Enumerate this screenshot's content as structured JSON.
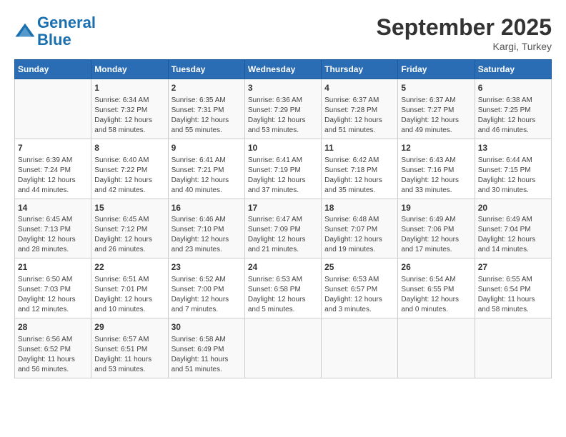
{
  "logo": {
    "line1": "General",
    "line2": "Blue"
  },
  "title": "September 2025",
  "location": "Kargi, Turkey",
  "days_of_week": [
    "Sunday",
    "Monday",
    "Tuesday",
    "Wednesday",
    "Thursday",
    "Friday",
    "Saturday"
  ],
  "weeks": [
    [
      {
        "day": "",
        "content": ""
      },
      {
        "day": "1",
        "content": "Sunrise: 6:34 AM\nSunset: 7:32 PM\nDaylight: 12 hours\nand 58 minutes."
      },
      {
        "day": "2",
        "content": "Sunrise: 6:35 AM\nSunset: 7:31 PM\nDaylight: 12 hours\nand 55 minutes."
      },
      {
        "day": "3",
        "content": "Sunrise: 6:36 AM\nSunset: 7:29 PM\nDaylight: 12 hours\nand 53 minutes."
      },
      {
        "day": "4",
        "content": "Sunrise: 6:37 AM\nSunset: 7:28 PM\nDaylight: 12 hours\nand 51 minutes."
      },
      {
        "day": "5",
        "content": "Sunrise: 6:37 AM\nSunset: 7:27 PM\nDaylight: 12 hours\nand 49 minutes."
      },
      {
        "day": "6",
        "content": "Sunrise: 6:38 AM\nSunset: 7:25 PM\nDaylight: 12 hours\nand 46 minutes."
      }
    ],
    [
      {
        "day": "7",
        "content": "Sunrise: 6:39 AM\nSunset: 7:24 PM\nDaylight: 12 hours\nand 44 minutes."
      },
      {
        "day": "8",
        "content": "Sunrise: 6:40 AM\nSunset: 7:22 PM\nDaylight: 12 hours\nand 42 minutes."
      },
      {
        "day": "9",
        "content": "Sunrise: 6:41 AM\nSunset: 7:21 PM\nDaylight: 12 hours\nand 40 minutes."
      },
      {
        "day": "10",
        "content": "Sunrise: 6:41 AM\nSunset: 7:19 PM\nDaylight: 12 hours\nand 37 minutes."
      },
      {
        "day": "11",
        "content": "Sunrise: 6:42 AM\nSunset: 7:18 PM\nDaylight: 12 hours\nand 35 minutes."
      },
      {
        "day": "12",
        "content": "Sunrise: 6:43 AM\nSunset: 7:16 PM\nDaylight: 12 hours\nand 33 minutes."
      },
      {
        "day": "13",
        "content": "Sunrise: 6:44 AM\nSunset: 7:15 PM\nDaylight: 12 hours\nand 30 minutes."
      }
    ],
    [
      {
        "day": "14",
        "content": "Sunrise: 6:45 AM\nSunset: 7:13 PM\nDaylight: 12 hours\nand 28 minutes."
      },
      {
        "day": "15",
        "content": "Sunrise: 6:45 AM\nSunset: 7:12 PM\nDaylight: 12 hours\nand 26 minutes."
      },
      {
        "day": "16",
        "content": "Sunrise: 6:46 AM\nSunset: 7:10 PM\nDaylight: 12 hours\nand 23 minutes."
      },
      {
        "day": "17",
        "content": "Sunrise: 6:47 AM\nSunset: 7:09 PM\nDaylight: 12 hours\nand 21 minutes."
      },
      {
        "day": "18",
        "content": "Sunrise: 6:48 AM\nSunset: 7:07 PM\nDaylight: 12 hours\nand 19 minutes."
      },
      {
        "day": "19",
        "content": "Sunrise: 6:49 AM\nSunset: 7:06 PM\nDaylight: 12 hours\nand 17 minutes."
      },
      {
        "day": "20",
        "content": "Sunrise: 6:49 AM\nSunset: 7:04 PM\nDaylight: 12 hours\nand 14 minutes."
      }
    ],
    [
      {
        "day": "21",
        "content": "Sunrise: 6:50 AM\nSunset: 7:03 PM\nDaylight: 12 hours\nand 12 minutes."
      },
      {
        "day": "22",
        "content": "Sunrise: 6:51 AM\nSunset: 7:01 PM\nDaylight: 12 hours\nand 10 minutes."
      },
      {
        "day": "23",
        "content": "Sunrise: 6:52 AM\nSunset: 7:00 PM\nDaylight: 12 hours\nand 7 minutes."
      },
      {
        "day": "24",
        "content": "Sunrise: 6:53 AM\nSunset: 6:58 PM\nDaylight: 12 hours\nand 5 minutes."
      },
      {
        "day": "25",
        "content": "Sunrise: 6:53 AM\nSunset: 6:57 PM\nDaylight: 12 hours\nand 3 minutes."
      },
      {
        "day": "26",
        "content": "Sunrise: 6:54 AM\nSunset: 6:55 PM\nDaylight: 12 hours\nand 0 minutes."
      },
      {
        "day": "27",
        "content": "Sunrise: 6:55 AM\nSunset: 6:54 PM\nDaylight: 11 hours\nand 58 minutes."
      }
    ],
    [
      {
        "day": "28",
        "content": "Sunrise: 6:56 AM\nSunset: 6:52 PM\nDaylight: 11 hours\nand 56 minutes."
      },
      {
        "day": "29",
        "content": "Sunrise: 6:57 AM\nSunset: 6:51 PM\nDaylight: 11 hours\nand 53 minutes."
      },
      {
        "day": "30",
        "content": "Sunrise: 6:58 AM\nSunset: 6:49 PM\nDaylight: 11 hours\nand 51 minutes."
      },
      {
        "day": "",
        "content": ""
      },
      {
        "day": "",
        "content": ""
      },
      {
        "day": "",
        "content": ""
      },
      {
        "day": "",
        "content": ""
      }
    ]
  ]
}
